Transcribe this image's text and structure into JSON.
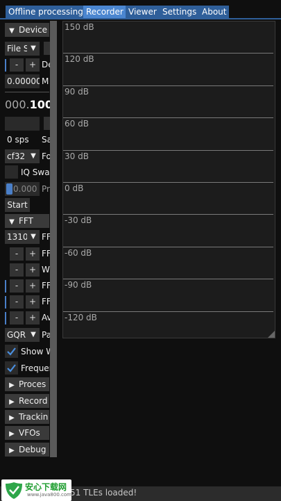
{
  "tabs": [
    {
      "label": "Offline processing",
      "active": false
    },
    {
      "label": "Recorder",
      "active": true
    },
    {
      "label": "Viewer",
      "active": false
    },
    {
      "label": "Settings",
      "active": false
    },
    {
      "label": "About",
      "active": false
    }
  ],
  "side": {
    "device_header": "Device",
    "source_combo": "File S",
    "stepper_minus": "-",
    "stepper_plus": "+",
    "row3_label": "De",
    "offset_value": "0.00000",
    "offset_label": "M",
    "freq_readout_a": "000.",
    "freq_readout_b": "100",
    "sample_rate_value": "0 sps",
    "sample_rate_label": "Sa",
    "format_combo": "cf32",
    "format_label": "Fo",
    "iq_swap_label": "IQ Swap",
    "progress_value": "0.000",
    "progress_label": "Pr",
    "start_button": "Start",
    "fft_header": "FFT",
    "fft_size_combo": "1310",
    "fft_size_label": "FF",
    "row_ff2_label": "FF",
    "row_w_label": "W",
    "row_ff3_label": "FF",
    "row_ff4_label": "FF",
    "row_av_label": "Av",
    "palette_combo": "GQR",
    "palette_label": "Pa",
    "show_waterfall_label": "Show W",
    "frequency_label": "Frequen",
    "processing_header": "Proces",
    "record_header": "Record",
    "tracking_header": "Trackin",
    "vfos_header": "VFOs",
    "debug_header": "Debug"
  },
  "plot": {
    "db_labels": [
      "150 dB",
      "120 dB",
      "90 dB",
      "60 dB",
      "30 dB",
      "0 dB",
      "-30 dB",
      "-60 dB",
      "-90 dB",
      "-120 dB"
    ]
  },
  "status": {
    "text": "51 TLEs loaded!"
  },
  "watermark": {
    "text": "安心下载网",
    "url": "www.java800.com"
  },
  "colors": {
    "tab": "#2f5f9a",
    "tab_active": "#4b86d0",
    "accent": "#4a7fc8",
    "background": "#0f0f0f"
  }
}
